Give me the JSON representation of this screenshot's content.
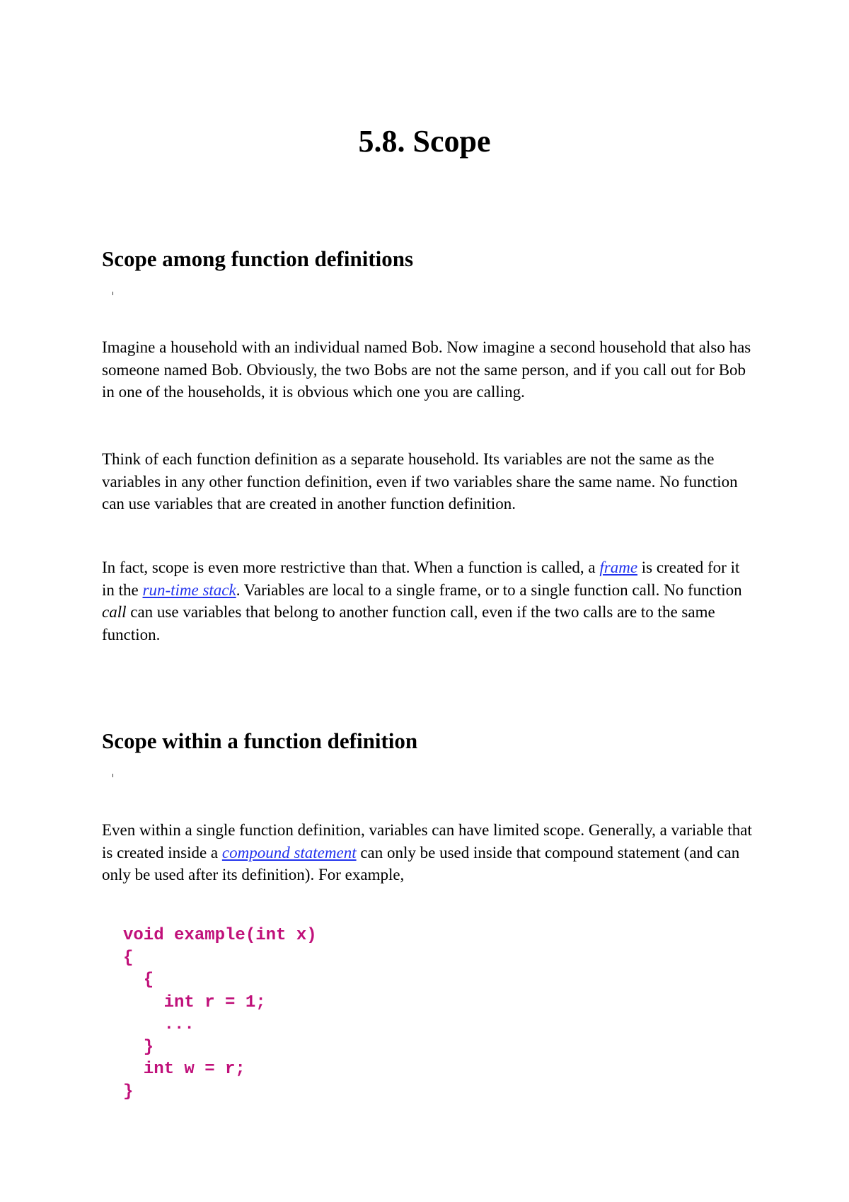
{
  "title": "5.8. Scope",
  "sections": [
    {
      "heading": "Scope among function definitions",
      "paragraphs": [
        {
          "text": "Imagine a household with an individual named Bob. Now imagine a second household that also has someone named Bob. Obviously, the two Bobs are not the same person, and if you call out for Bob in one of the households, it is obvious which one you are calling."
        },
        {
          "text": "Think of each function definition as a separate household. Its variables are not the same as the variables in any other function definition, even if two variables share the same name. No function can use variables that are created in another function definition."
        },
        {
          "part1": "In fact, scope is even more restrictive than that. When a function is called, a ",
          "link1": "frame",
          "part2": " is created for it in the ",
          "link2": "run-time stack",
          "part3": ". Variables are local to a single frame, or to a single function call. No function ",
          "emph": "call",
          "part4": " can use variables that belong to another function call, even if the two calls are to the same function."
        }
      ]
    },
    {
      "heading": "Scope within a function definition",
      "paragraphs": [
        {
          "part1": "Even within a single function definition, variables can have limited scope. Generally, a variable that is created inside a ",
          "link1": "compound statement",
          "part2": " can only be used inside that compound statement (and can only be used after its definition). For example,"
        }
      ],
      "code": "void example(int x)\n{\n  {\n    int r = 1;\n    ...\n  }\n  int w = r;\n}"
    }
  ],
  "colors": {
    "link": "#2233ee",
    "code": "#c0107a"
  }
}
